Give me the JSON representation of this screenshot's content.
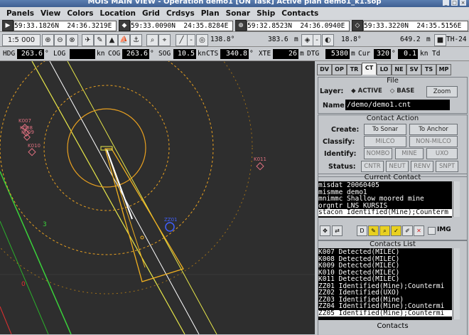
{
  "window": {
    "title": "MOIS MAIN VIEW - Operation demo1 [ON Task]     Active plan demo1_k1.sop"
  },
  "menu": [
    "Panels",
    "View",
    "Colors",
    "Location",
    "Grid",
    "Crdsys",
    "Plan",
    "Sonar",
    "Ship",
    "Contacts"
  ],
  "coords": {
    "pos1_lat": "59:33.1826N",
    "pos1_lon": "24:36.3219E",
    "pos2_lat": "59:33.0090N",
    "pos2_lon": "24:35.8284E",
    "pos3_lat": "59:32.8523N",
    "pos3_lon": "24:36.0940E",
    "pos4_lat": "59:33.3220N",
    "pos4_lon": "24:35.5156E"
  },
  "toolbar": {
    "scale": "1:5 000",
    "bearing1": "138.8°",
    "range1": "383.6",
    "unit1": "m",
    "bearing2": "18.8°",
    "range2": "649.2",
    "unit2": "m",
    "track": "TH-24"
  },
  "nav": {
    "hdg_label": "HDG",
    "hdg": "263.6",
    "hdg_unit": "°",
    "log_label": "LOG",
    "log": "",
    "log_unit": "kn",
    "cog_label": "COG",
    "cog": "263.6",
    "cog_unit": "°",
    "sog_label": "SOG",
    "sog": "10.5",
    "sog_unit": "kn",
    "cts_label": "CTS",
    "cts": "340.8",
    "cts_unit": "°",
    "xte_label": "XTE",
    "xte": "26",
    "xte_unit": "m",
    "dtg_label": "DTG",
    "dtg": "5380",
    "dtg_unit": "m",
    "cur_label": "Cur",
    "cur": "320",
    "cur_unit": "°",
    "cur_speed": "0.1",
    "cur_speed_unit": "kn",
    "td_label": "Td"
  },
  "map": {
    "contacts": [
      "K007",
      "K008",
      "K009",
      "K010",
      "K011",
      "ZZ01"
    ],
    "line_labels": [
      "3",
      "0"
    ]
  },
  "panel": {
    "tabs": [
      "DV",
      "OP",
      "TR",
      "CT",
      "LO",
      "NE",
      "SV",
      "TS",
      "MP"
    ],
    "active_tab": "CT",
    "file": {
      "title": "File",
      "layer_label": "Layer:",
      "active_label": "ACTIVE",
      "base_label": "BASE",
      "zoom_label": "Zoom",
      "name_label": "Name:",
      "name_value": "/demo/demo1.cnt"
    },
    "contact_action": {
      "title": "Contact Action",
      "create_label": "Create:",
      "to_sonar": "To Sonar",
      "to_anchor": "To Anchor",
      "classify_label": "Classify:",
      "milco": "MILCO",
      "non_milco": "NON-MILCO",
      "identify_label": "Identify:",
      "nombo": "NOMBO",
      "mine": "MINE",
      "uxo": "UXO",
      "status_label": "Status:",
      "cntr": "CNTR",
      "neut": "NEUT",
      "renv": "RENV",
      "snpt": "SNPT"
    },
    "current_contact": {
      "title": "Current Contact",
      "lines": [
        "misdat 20060405",
        "mismme demo1",
        "mnimmc Shallow moored mine",
        "orgntr LNS KURSIS",
        "stacon Identified(Mine);Counterm"
      ],
      "img_label": "IMG"
    },
    "contacts_list": {
      "title": "Contacts List",
      "items": [
        "K007  Detected(MILEC)",
        "K008  Detected(MILEC)",
        "K009  Detected(MILEC)",
        "K010  Detected(MILEC)",
        "K011  Detected(MILEC)",
        "ZZ01  Identified(Mine);Countermi",
        "ZZ02  Identified(UXO)",
        "ZZ03  Identified(Mine)",
        "ZZ04  Identified(Mine);Countermi",
        "ZZ05  Identified(Mine);Countermi"
      ],
      "selected_index": 9,
      "footer": "Contacts"
    }
  }
}
